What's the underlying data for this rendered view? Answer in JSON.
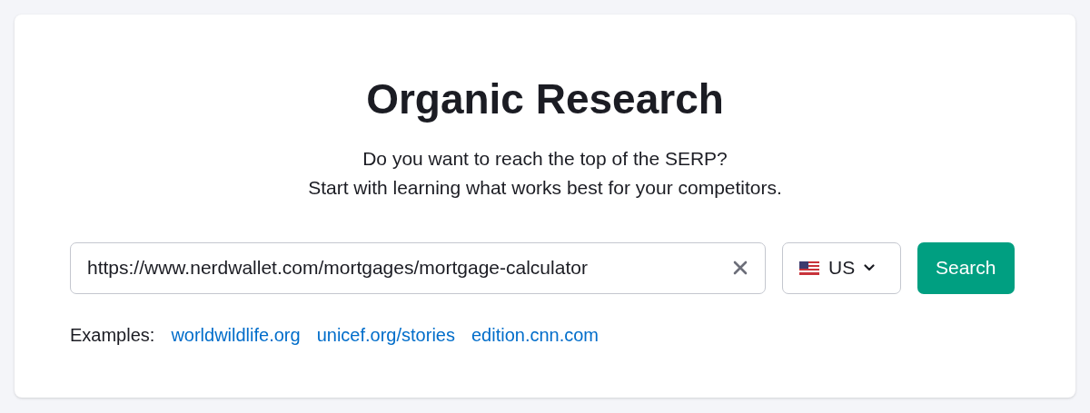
{
  "title": "Organic Research",
  "subtitle_lines": [
    "Do you want to reach the top of the SERP?",
    "Start with learning what works best for your competitors."
  ],
  "search_field": {
    "value": "https://www.nerdwallet.com/mortgages/mortgage-calculator"
  },
  "country_select": {
    "label": "US"
  },
  "search_button": "Search",
  "examples": {
    "label": "Examples:",
    "links": [
      "worldwildlife.org",
      "unicef.org/stories",
      "edition.cnn.com"
    ]
  }
}
